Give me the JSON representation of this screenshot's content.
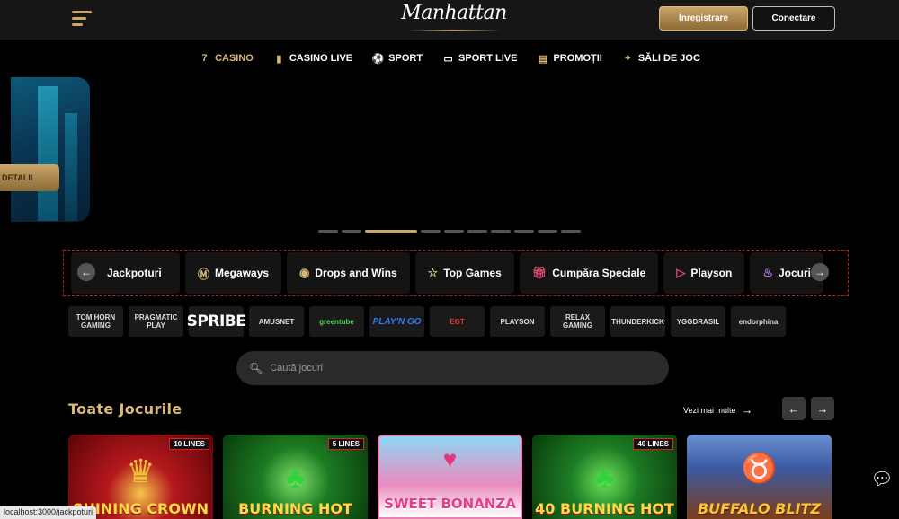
{
  "header": {
    "logo_text": "Manhattan",
    "register_label": "Înregistrare",
    "login_label": "Conectare"
  },
  "nav": [
    {
      "label": "CASINO",
      "icon": "seven-icon",
      "active": true
    },
    {
      "label": "CASINO LIVE",
      "icon": "card-icon"
    },
    {
      "label": "SPORT",
      "icon": "soccer-ball-icon"
    },
    {
      "label": "SPORT LIVE",
      "icon": "tv-play-icon"
    },
    {
      "label": "PROMOȚII",
      "icon": "ticket-icon"
    },
    {
      "label": "SĂLI DE JOC",
      "icon": "location-pin-icon"
    }
  ],
  "hero": {
    "button_label": "DETALII",
    "slide_count": 11,
    "active_slide": 3
  },
  "categories": [
    {
      "label": "Jackpoturi",
      "icon": "jackpot-icon"
    },
    {
      "label": "Megaways",
      "icon": "megaways-m-icon"
    },
    {
      "label": "Drops and Wins",
      "icon": "drops-wins-icon"
    },
    {
      "label": "Top Games",
      "icon": "star-icon"
    },
    {
      "label": "Cumpăra Speciale",
      "icon": "gift-icon"
    },
    {
      "label": "Playson",
      "icon": "play-triangle-icon"
    },
    {
      "label": "Jocuri",
      "icon": "flame-icon"
    }
  ],
  "providers": [
    "TOM HORN GAMING",
    "PRAGMATIC PLAY",
    "SPRIBE",
    "AMUSNET",
    "greentube",
    "PLAY'N GO",
    "EGT",
    "PLAYSON",
    "RELAX GAMING",
    "THUNDERKICK",
    "YGGDRASIL",
    "endorphina"
  ],
  "search": {
    "placeholder": "Caută jocuri"
  },
  "games_section": {
    "title": "Toate Jocurile",
    "see_more": "Vezi mai multe"
  },
  "games": [
    {
      "title": "SHINING CROWN",
      "badge": "10 LINES"
    },
    {
      "title": "BURNING HOT",
      "badge": "5 LINES"
    },
    {
      "title": "SWEET BONANZA",
      "badge": ""
    },
    {
      "title": "40 BURNING HOT",
      "badge": "40 LINES"
    },
    {
      "title": "BUFFALO BLITZ",
      "badge": ""
    }
  ],
  "status_url": "localhost:3000/jackpoturi",
  "colors": {
    "accent_gold": "#c9a56a",
    "background": "#000000",
    "header_bg": "#161616",
    "category_border": "#cc1b1b"
  }
}
